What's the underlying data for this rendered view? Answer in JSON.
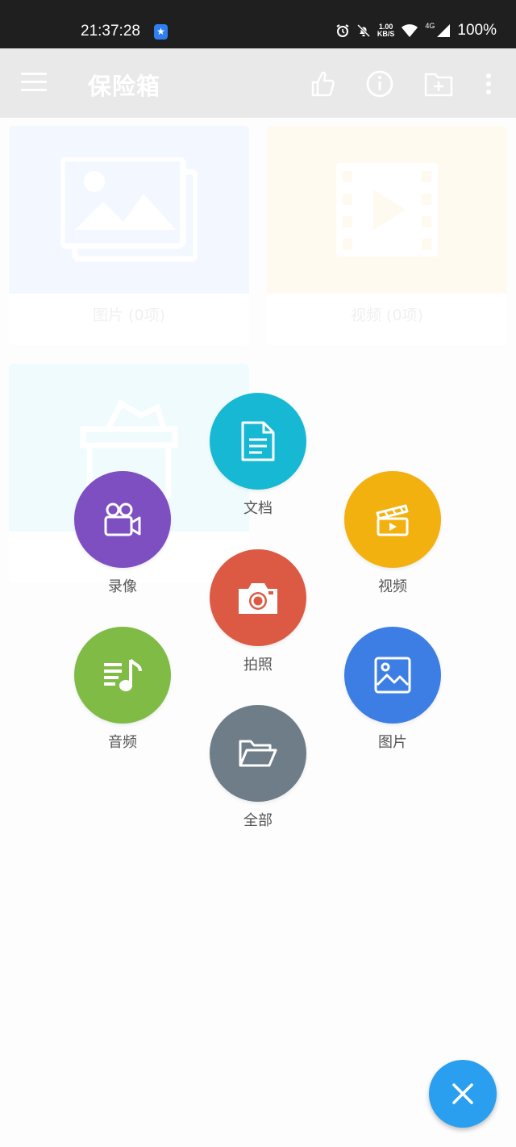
{
  "status_bar": {
    "time": "21:37:28",
    "speed_value": "1.00",
    "speed_unit": "KB/S",
    "network": "4G",
    "battery": "100%"
  },
  "app_bar": {
    "title": "保险箱",
    "actions": [
      "thumbs-up-icon",
      "info-icon",
      "add-folder-icon",
      "more-vert-icon"
    ]
  },
  "categories": [
    {
      "label": "图片 (0项)",
      "color": "#eaf0ff",
      "icon": "image-stack-icon"
    },
    {
      "label": "视频 (0项)",
      "color": "#fff6e3",
      "icon": "film-icon"
    },
    {
      "label": "",
      "color": "#e3f7fb",
      "icon": "box-icon"
    }
  ],
  "radial_menu": {
    "document": {
      "label": "文档",
      "color": "#16b8d4"
    },
    "record": {
      "label": "录像",
      "color": "#7e4fc1"
    },
    "video": {
      "label": "视频",
      "color": "#f2b10e"
    },
    "photo": {
      "label": "拍照",
      "color": "#dc5a44"
    },
    "audio": {
      "label": "音频",
      "color": "#7fbb45"
    },
    "image": {
      "label": "图片",
      "color": "#3d7ee5"
    },
    "all": {
      "label": "全部",
      "color": "#6f7d88"
    }
  },
  "fab": {
    "icon": "close-icon",
    "color": "#2a9ff0"
  }
}
